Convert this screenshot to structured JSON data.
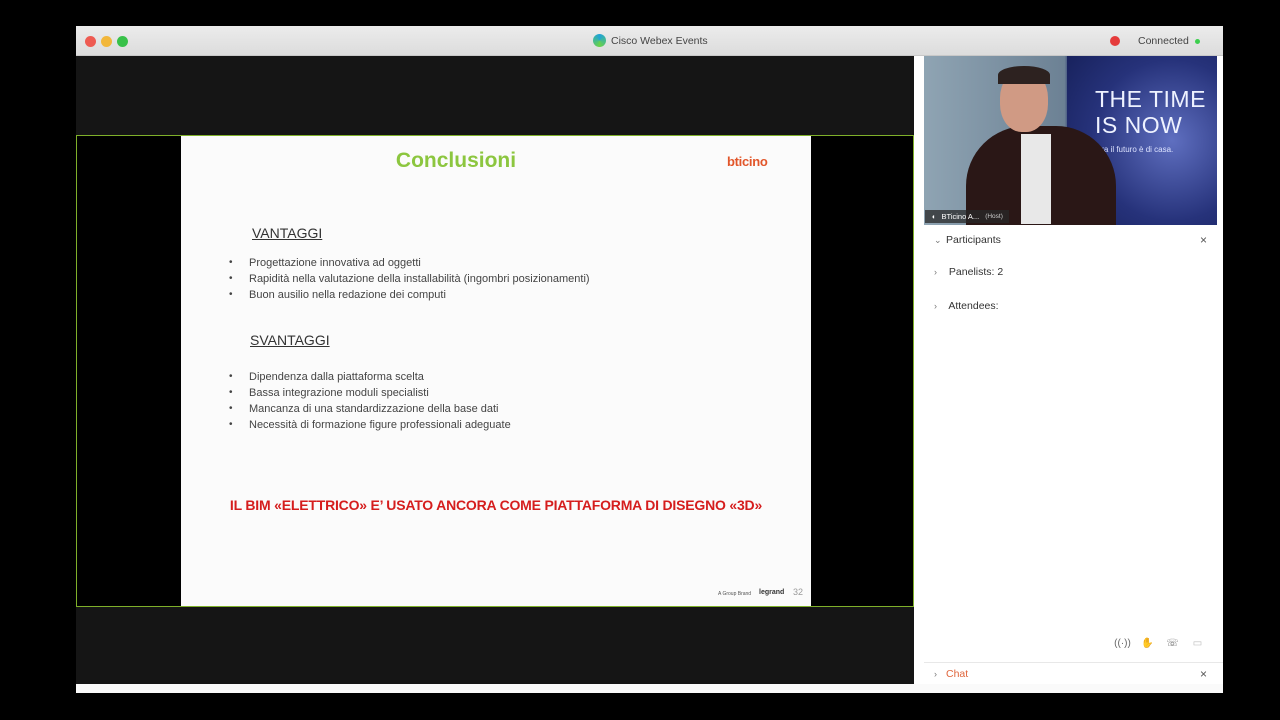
{
  "app": {
    "title": "Cisco Webex Events",
    "status": "Connected"
  },
  "slide": {
    "title": "Conclusioni",
    "brand": "bticino",
    "advantages_heading": "VANTAGGI",
    "advantages": [
      "Progettazione innovativa ad oggetti",
      "Rapidità nella valutazione della installabilità (ingombri posizionamenti)",
      "Buon ausilio nella redazione dei computi"
    ],
    "disadvantages_heading": "SVANTAGGI",
    "disadvantages": [
      "Dipendenza dalla piattaforma scelta",
      "Bassa integrazione moduli specialisti",
      "Mancanza di una standardizzazione della base dati",
      "Necessità di formazione figure professionali adeguate"
    ],
    "highlight": "IL BIM «ELETTRICO» E’ USATO ANCORA COME PIATTAFORMA DI DISEGNO «3D»",
    "footer_brand": "A Group Brand",
    "footer_logo": "legrand",
    "page_number": "32"
  },
  "video": {
    "speaker_name": "BTicino A...",
    "speaker_role": "(Host)",
    "banner_line1": "THE TIME",
    "banner_line2": "IS NOW",
    "banner_sub": "Ora il futuro è di casa."
  },
  "panel": {
    "title": "Participants",
    "panelists": "Panelists: 2",
    "attendees": "Attendees:",
    "chat_label": "Chat"
  },
  "icons": {
    "close": "×",
    "chevron_down": "⌄",
    "chevron_right": "›"
  }
}
